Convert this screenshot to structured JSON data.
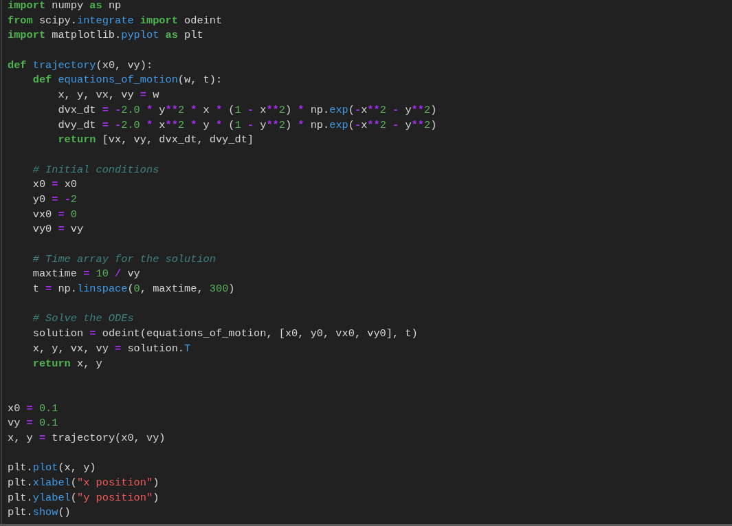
{
  "editor": {
    "lines": [
      {
        "kind": "code",
        "tokens": [
          {
            "kind": "keyword",
            "text": "import"
          },
          {
            "kind": "plain",
            "text": " numpy "
          },
          {
            "kind": "keyword",
            "text": "as"
          },
          {
            "kind": "plain",
            "text": " np"
          }
        ]
      },
      {
        "kind": "code",
        "tokens": [
          {
            "kind": "keyword",
            "text": "from"
          },
          {
            "kind": "plain",
            "text": " scipy."
          },
          {
            "kind": "function",
            "text": "integrate"
          },
          {
            "kind": "keyword",
            "text": " import"
          },
          {
            "kind": "plain",
            "text": " odeint"
          }
        ]
      },
      {
        "kind": "code",
        "tokens": [
          {
            "kind": "keyword",
            "text": "import"
          },
          {
            "kind": "plain",
            "text": " matplotlib."
          },
          {
            "kind": "function",
            "text": "pyplot"
          },
          {
            "kind": "keyword",
            "text": " as"
          },
          {
            "kind": "plain",
            "text": " plt"
          }
        ]
      },
      {
        "kind": "blank"
      },
      {
        "kind": "code",
        "tokens": [
          {
            "kind": "keyword",
            "text": "def"
          },
          {
            "kind": "function",
            "text": " trajectory"
          },
          {
            "kind": "plain",
            "text": "(x0, vy):"
          }
        ]
      },
      {
        "kind": "code",
        "tokens": [
          {
            "kind": "keyword",
            "text": "    def"
          },
          {
            "kind": "function",
            "text": " equations_of_motion"
          },
          {
            "kind": "plain",
            "text": "(w, t):"
          }
        ]
      },
      {
        "kind": "code",
        "tokens": [
          {
            "kind": "plain",
            "text": "        x, y, vx, vy "
          },
          {
            "kind": "operator",
            "text": "="
          },
          {
            "kind": "plain",
            "text": " w"
          }
        ]
      },
      {
        "kind": "code",
        "tokens": [
          {
            "kind": "plain",
            "text": "        dvx_dt "
          },
          {
            "kind": "operator",
            "text": "="
          },
          {
            "kind": "operator",
            "text": " -"
          },
          {
            "kind": "number",
            "text": "2.0"
          },
          {
            "kind": "operator",
            "text": " *"
          },
          {
            "kind": "plain",
            "text": " y"
          },
          {
            "kind": "operator",
            "text": "**"
          },
          {
            "kind": "number",
            "text": "2"
          },
          {
            "kind": "operator",
            "text": " *"
          },
          {
            "kind": "plain",
            "text": " x "
          },
          {
            "kind": "operator",
            "text": "*"
          },
          {
            "kind": "plain",
            "text": " ("
          },
          {
            "kind": "number",
            "text": "1"
          },
          {
            "kind": "operator",
            "text": " -"
          },
          {
            "kind": "plain",
            "text": " x"
          },
          {
            "kind": "operator",
            "text": "**"
          },
          {
            "kind": "number",
            "text": "2"
          },
          {
            "kind": "plain",
            "text": ") "
          },
          {
            "kind": "operator",
            "text": "*"
          },
          {
            "kind": "plain",
            "text": " np."
          },
          {
            "kind": "function",
            "text": "exp"
          },
          {
            "kind": "plain",
            "text": "("
          },
          {
            "kind": "operator",
            "text": "-"
          },
          {
            "kind": "plain",
            "text": "x"
          },
          {
            "kind": "operator",
            "text": "**"
          },
          {
            "kind": "number",
            "text": "2"
          },
          {
            "kind": "operator",
            "text": " -"
          },
          {
            "kind": "plain",
            "text": " y"
          },
          {
            "kind": "operator",
            "text": "**"
          },
          {
            "kind": "number",
            "text": "2"
          },
          {
            "kind": "plain",
            "text": ")"
          }
        ]
      },
      {
        "kind": "code",
        "tokens": [
          {
            "kind": "plain",
            "text": "        dvy_dt "
          },
          {
            "kind": "operator",
            "text": "="
          },
          {
            "kind": "operator",
            "text": " -"
          },
          {
            "kind": "number",
            "text": "2.0"
          },
          {
            "kind": "operator",
            "text": " *"
          },
          {
            "kind": "plain",
            "text": " x"
          },
          {
            "kind": "operator",
            "text": "**"
          },
          {
            "kind": "number",
            "text": "2"
          },
          {
            "kind": "operator",
            "text": " *"
          },
          {
            "kind": "plain",
            "text": " y "
          },
          {
            "kind": "operator",
            "text": "*"
          },
          {
            "kind": "plain",
            "text": " ("
          },
          {
            "kind": "number",
            "text": "1"
          },
          {
            "kind": "operator",
            "text": " -"
          },
          {
            "kind": "plain",
            "text": " y"
          },
          {
            "kind": "operator",
            "text": "**"
          },
          {
            "kind": "number",
            "text": "2"
          },
          {
            "kind": "plain",
            "text": ") "
          },
          {
            "kind": "operator",
            "text": "*"
          },
          {
            "kind": "plain",
            "text": " np."
          },
          {
            "kind": "function",
            "text": "exp"
          },
          {
            "kind": "plain",
            "text": "("
          },
          {
            "kind": "operator",
            "text": "-"
          },
          {
            "kind": "plain",
            "text": "x"
          },
          {
            "kind": "operator",
            "text": "**"
          },
          {
            "kind": "number",
            "text": "2"
          },
          {
            "kind": "operator",
            "text": " -"
          },
          {
            "kind": "plain",
            "text": " y"
          },
          {
            "kind": "operator",
            "text": "**"
          },
          {
            "kind": "number",
            "text": "2"
          },
          {
            "kind": "plain",
            "text": ")"
          }
        ]
      },
      {
        "kind": "code",
        "tokens": [
          {
            "kind": "keyword",
            "text": "        return"
          },
          {
            "kind": "plain",
            "text": " [vx, vy, dvx_dt, dvy_dt]"
          }
        ]
      },
      {
        "kind": "blank"
      },
      {
        "kind": "code",
        "tokens": [
          {
            "kind": "comment",
            "text": "    # Initial conditions"
          }
        ]
      },
      {
        "kind": "code",
        "tokens": [
          {
            "kind": "plain",
            "text": "    x0 "
          },
          {
            "kind": "operator",
            "text": "="
          },
          {
            "kind": "plain",
            "text": " x0"
          }
        ]
      },
      {
        "kind": "code",
        "tokens": [
          {
            "kind": "plain",
            "text": "    y0 "
          },
          {
            "kind": "operator",
            "text": "="
          },
          {
            "kind": "operator",
            "text": " -"
          },
          {
            "kind": "number",
            "text": "2"
          }
        ]
      },
      {
        "kind": "code",
        "tokens": [
          {
            "kind": "plain",
            "text": "    vx0 "
          },
          {
            "kind": "operator",
            "text": "="
          },
          {
            "kind": "number",
            "text": " 0"
          }
        ]
      },
      {
        "kind": "code",
        "tokens": [
          {
            "kind": "plain",
            "text": "    vy0 "
          },
          {
            "kind": "operator",
            "text": "="
          },
          {
            "kind": "plain",
            "text": " vy"
          }
        ]
      },
      {
        "kind": "blank"
      },
      {
        "kind": "code",
        "tokens": [
          {
            "kind": "comment",
            "text": "    # Time array for the solution"
          }
        ]
      },
      {
        "kind": "code",
        "tokens": [
          {
            "kind": "plain",
            "text": "    maxtime "
          },
          {
            "kind": "operator",
            "text": "="
          },
          {
            "kind": "number",
            "text": " 10"
          },
          {
            "kind": "operator",
            "text": " /"
          },
          {
            "kind": "plain",
            "text": " vy"
          }
        ]
      },
      {
        "kind": "code",
        "tokens": [
          {
            "kind": "plain",
            "text": "    t "
          },
          {
            "kind": "operator",
            "text": "="
          },
          {
            "kind": "plain",
            "text": " np."
          },
          {
            "kind": "function",
            "text": "linspace"
          },
          {
            "kind": "plain",
            "text": "("
          },
          {
            "kind": "number",
            "text": "0"
          },
          {
            "kind": "plain",
            "text": ", maxtime, "
          },
          {
            "kind": "number",
            "text": "300"
          },
          {
            "kind": "plain",
            "text": ")"
          }
        ]
      },
      {
        "kind": "blank"
      },
      {
        "kind": "code",
        "tokens": [
          {
            "kind": "comment",
            "text": "    # Solve the ODEs"
          }
        ]
      },
      {
        "kind": "code",
        "tokens": [
          {
            "kind": "plain",
            "text": "    solution "
          },
          {
            "kind": "operator",
            "text": "="
          },
          {
            "kind": "plain",
            "text": " odeint(equations_of_motion, [x0, y0, vx0, vy0], t)"
          }
        ]
      },
      {
        "kind": "code",
        "tokens": [
          {
            "kind": "plain",
            "text": "    x, y, vx, vy "
          },
          {
            "kind": "operator",
            "text": "="
          },
          {
            "kind": "plain",
            "text": " solution."
          },
          {
            "kind": "function",
            "text": "T"
          }
        ]
      },
      {
        "kind": "code",
        "tokens": [
          {
            "kind": "keyword",
            "text": "    return"
          },
          {
            "kind": "plain",
            "text": " x, y"
          }
        ]
      },
      {
        "kind": "blank"
      },
      {
        "kind": "blank"
      },
      {
        "kind": "code",
        "tokens": [
          {
            "kind": "plain",
            "text": "x0 "
          },
          {
            "kind": "operator",
            "text": "="
          },
          {
            "kind": "number",
            "text": " 0.1"
          }
        ]
      },
      {
        "kind": "code",
        "tokens": [
          {
            "kind": "plain",
            "text": "vy "
          },
          {
            "kind": "operator",
            "text": "="
          },
          {
            "kind": "number",
            "text": " 0.1"
          }
        ]
      },
      {
        "kind": "code",
        "tokens": [
          {
            "kind": "plain",
            "text": "x, y "
          },
          {
            "kind": "operator",
            "text": "="
          },
          {
            "kind": "plain",
            "text": " trajectory(x0, vy)"
          }
        ]
      },
      {
        "kind": "blank"
      },
      {
        "kind": "code",
        "tokens": [
          {
            "kind": "plain",
            "text": "plt."
          },
          {
            "kind": "function",
            "text": "plot"
          },
          {
            "kind": "plain",
            "text": "(x, y)"
          }
        ]
      },
      {
        "kind": "code",
        "tokens": [
          {
            "kind": "plain",
            "text": "plt."
          },
          {
            "kind": "function",
            "text": "xlabel"
          },
          {
            "kind": "plain",
            "text": "("
          },
          {
            "kind": "string",
            "text": "\"x position\""
          },
          {
            "kind": "plain",
            "text": ")"
          }
        ]
      },
      {
        "kind": "code",
        "tokens": [
          {
            "kind": "plain",
            "text": "plt."
          },
          {
            "kind": "function",
            "text": "ylabel"
          },
          {
            "kind": "plain",
            "text": "("
          },
          {
            "kind": "string",
            "text": "\"y position\""
          },
          {
            "kind": "plain",
            "text": ")"
          }
        ]
      },
      {
        "kind": "code",
        "tokens": [
          {
            "kind": "plain",
            "text": "plt."
          },
          {
            "kind": "function",
            "text": "show"
          },
          {
            "kind": "plain",
            "text": "()"
          }
        ]
      }
    ]
  }
}
